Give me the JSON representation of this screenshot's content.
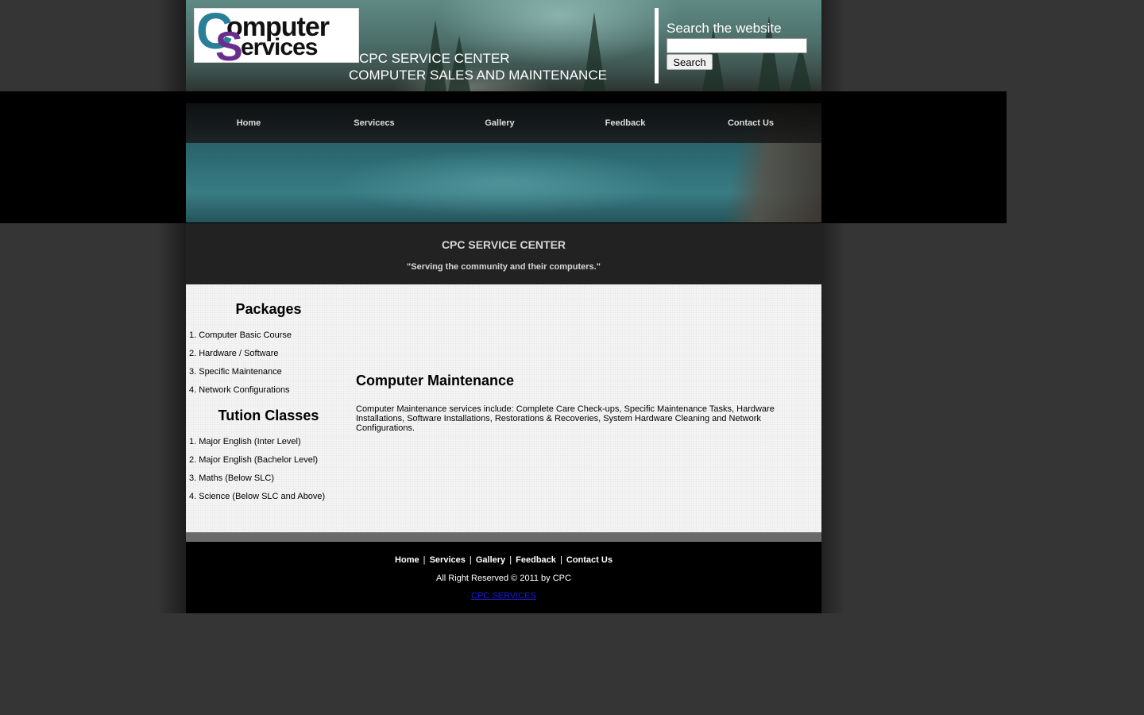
{
  "header": {
    "logo_line1": "omputer",
    "logo_line2": "ervices",
    "logo_c": "C",
    "logo_s": "S",
    "title": "CPC SERVICE CENTER",
    "subtitle": "COMPUTER SALES AND MAINTENANCE"
  },
  "search": {
    "heading": "Search the website",
    "value": "",
    "button_label": "Search"
  },
  "nav": {
    "items": [
      {
        "label": "Home"
      },
      {
        "label": "Servicecs"
      },
      {
        "label": "Gallery"
      },
      {
        "label": "Feedback"
      },
      {
        "label": "Contact Us"
      }
    ]
  },
  "intro": {
    "title": "CPC SERVICE CENTER",
    "tagline": "\"Serving the community and their computers.\""
  },
  "sidebar": {
    "packages_heading": "Packages",
    "packages": [
      "1. Computer Basic Course",
      "2. Hardware / Software",
      "3. Specific Maintenance",
      "4. Network Configurations"
    ],
    "tuition_heading": "Tution Classes",
    "tuition": [
      "1. Major English (Inter Level)",
      "2. Major English (Bachelor Level)",
      "3. Maths (Below SLC)",
      "4. Science (Below SLC and Above)"
    ]
  },
  "main": {
    "heading": "Computer Maintenance",
    "text": "Computer Maintenance services include: Complete Care Check-ups, Specific Maintenance Tasks, Hardware Installations, Software Installations, Restorations & Recoveries, System Hardware Cleaning and Network Configurations."
  },
  "footer": {
    "links": [
      "Home",
      "Services",
      "Gallery",
      "Feedback",
      "Contact Us"
    ],
    "separator": "|",
    "copyright": "All Right Reserved © 2011 by CPC",
    "credit": "CPC SERVICES"
  },
  "colors": {
    "background": "#353535",
    "band": "#000000",
    "title_strip": "#222222",
    "content_bg": "#f5f5f5",
    "logo_blue": "#2a7f98",
    "logo_purple": "#6b2c8f",
    "footer_link": "#1a1adb"
  }
}
